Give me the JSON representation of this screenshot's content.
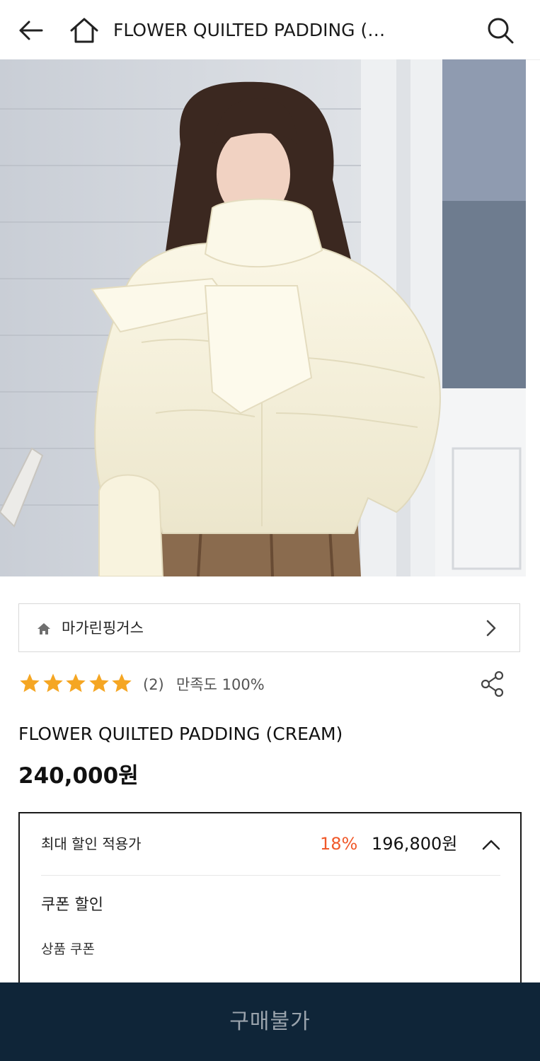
{
  "header": {
    "title": "FLOWER QUILTED PADDING (…",
    "icons": {
      "back": "arrow-left-icon",
      "home": "home-icon",
      "search": "search-icon"
    }
  },
  "product_image": {
    "alt": "product-photo"
  },
  "shop": {
    "name": "마가린핑거스",
    "icon": "home-icon",
    "chevron": "chevron-right-icon"
  },
  "rating": {
    "stars_filled": 5,
    "stars_total": 5,
    "review_count": "(2)",
    "satisfaction": "만족도 100%",
    "share_icon": "share-icon",
    "star_color": "#f5a623"
  },
  "product": {
    "name": "FLOWER QUILTED PADDING (CREAM)",
    "price": "240,000원"
  },
  "discount": {
    "label": "최대 할인 적용가",
    "rate": "18%",
    "price": "196,800원",
    "toggle_icon": "chevron-up-icon",
    "coupon_title": "쿠폰 할인",
    "coupon_sub": "상품 쿠폰",
    "rate_color": "#f0592a"
  },
  "buy_button": {
    "label": "구매불가",
    "background": "#0f2538"
  }
}
